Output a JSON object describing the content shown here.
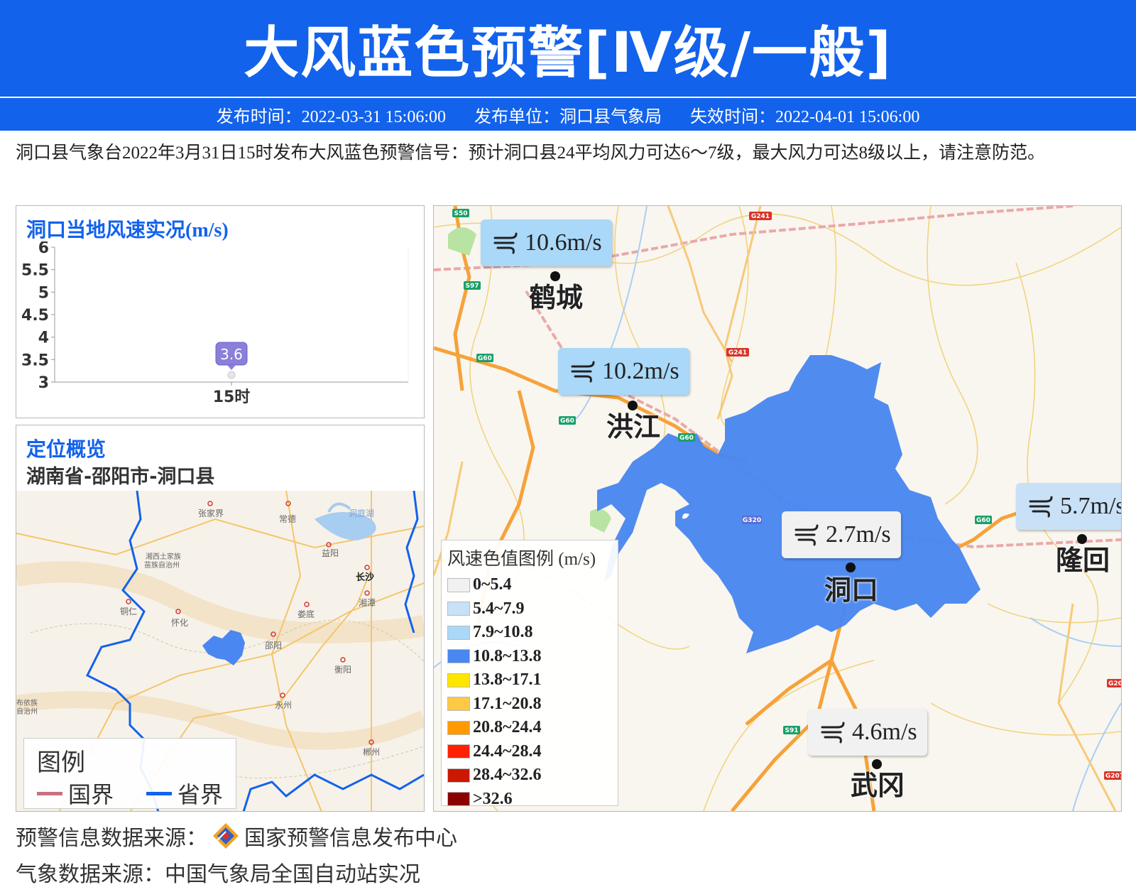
{
  "header": {
    "title": "大风蓝色预警[Ⅳ级/一般]",
    "publish_time": "发布时间：2022-03-31 15:06:00",
    "publisher": "发布单位：洞口县气象局",
    "expire_time": "失效时间：2022-04-01 15:06:00"
  },
  "description": "洞口县气象台2022年3月31日15时发布大风蓝色预警信号：预计洞口县24平均风力可达6～7级，最大风力可达8级以上，请注意防范。",
  "wind_panel": {
    "title": "洞口当地风速实况",
    "unit": "(m/s)"
  },
  "chart_data": {
    "type": "scatter",
    "title": "洞口当地风速实况(m/s)",
    "categories": [
      "15时"
    ],
    "values": [
      3.6
    ],
    "data_labels": [
      "3.6"
    ],
    "ylim": [
      3,
      6
    ],
    "yticks": [
      "3",
      "3.5",
      "4",
      "4.5",
      "5",
      "5.5",
      "6"
    ],
    "grid": false
  },
  "location_panel": {
    "title": "定位概览",
    "path": "湖南省-邵阳市-洞口县",
    "city_labels": [
      "张家界",
      "常德",
      "洞庭湖",
      "湘西土家族",
      "苗族自治州",
      "益阳",
      "长沙",
      "铜仁",
      "怀化",
      "娄底",
      "湘潭",
      "邵阳",
      "衡阳",
      "永州",
      "郴州",
      "布依族",
      "自治州"
    ],
    "legend": {
      "title": "图例",
      "national_border": "国界",
      "province_border": "省界",
      "national_color": "#c87080",
      "province_color": "#1262ec"
    }
  },
  "main_map": {
    "stations": [
      {
        "name": "鹤城",
        "wind": "10.6m/s",
        "bg": "#a9d8f8"
      },
      {
        "name": "洪江",
        "wind": "10.2m/s",
        "bg": "#a9d8f8"
      },
      {
        "name": "洞口",
        "wind": "2.7m/s",
        "bg": "#f1f1f1"
      },
      {
        "name": "隆回",
        "wind": "5.7m/s",
        "bg": "#c8e1f7"
      },
      {
        "name": "武冈",
        "wind": "4.6m/s",
        "bg": "#f1f1f1"
      }
    ],
    "road_labels": [
      "S50",
      "S97",
      "G60",
      "G60",
      "G60",
      "G241",
      "G241",
      "G320",
      "G60",
      "S91",
      "G20",
      "G207"
    ],
    "county_fill": "#4a87f0",
    "legend": {
      "title": "风速色值图例 (m/s)",
      "items": [
        {
          "label": "0~5.4",
          "color": "#f1f1f1"
        },
        {
          "label": "5.4~7.9",
          "color": "#c8e1f7"
        },
        {
          "label": "7.9~10.8",
          "color": "#a9d8f8"
        },
        {
          "label": "10.8~13.8",
          "color": "#4a87f0"
        },
        {
          "label": "13.8~17.1",
          "color": "#ffe600"
        },
        {
          "label": "17.1~20.8",
          "color": "#ffc845"
        },
        {
          "label": "20.8~24.4",
          "color": "#ff9a00"
        },
        {
          "label": "24.4~28.4",
          "color": "#ff2200"
        },
        {
          "label": "28.4~32.6",
          "color": "#cc1800"
        },
        {
          "label": ">32.6",
          "color": "#8b0000"
        }
      ]
    }
  },
  "footer": {
    "warning_source_label": "预警信息数据来源：",
    "warning_source_name": "国家预警信息发布中心",
    "weather_source": "气象数据来源：中国气象局全国自动站实况"
  }
}
